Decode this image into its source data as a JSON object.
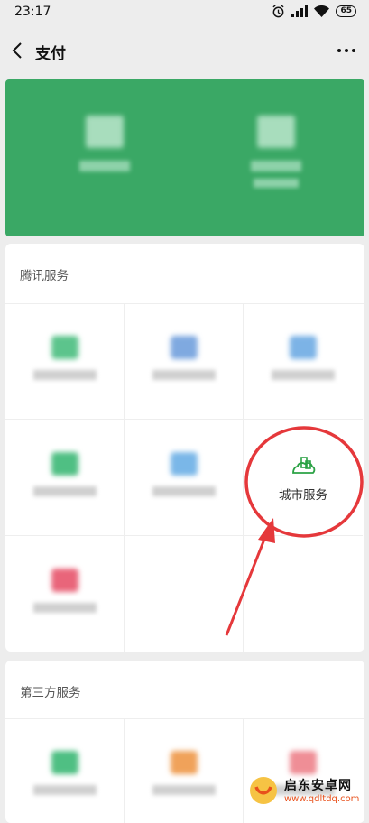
{
  "status": {
    "time": "23:17",
    "battery": "65"
  },
  "nav": {
    "title": "支付"
  },
  "sections": [
    {
      "title": "腾讯服务"
    },
    {
      "title": "第三方服务"
    }
  ],
  "city_service": {
    "label": "城市服务"
  },
  "colors": {
    "wallet_green": "#3aa865",
    "accent_green": "#2ba245",
    "annotation_red": "#e5383b"
  },
  "watermark": {
    "brand": "启东安卓网",
    "url": "www.qdltdq.com"
  }
}
